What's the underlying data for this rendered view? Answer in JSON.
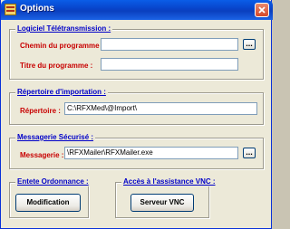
{
  "window": {
    "title": "Options",
    "colors": {
      "title_bar": "#0a4fd6",
      "group_title": "#0000c8",
      "label": "#c80000",
      "dialog_bg": "#ece9d8"
    }
  },
  "logiciel": {
    "title": "Logiciel Télétransmission :",
    "chemin_label": "Chemin du programme :",
    "chemin_value": "",
    "titre_label": "Titre du programme :",
    "titre_value": "",
    "browse_label": "..."
  },
  "repertoire": {
    "title": "Répertoire d'importation :",
    "label": "Répertoire :",
    "value": "C:\\RFXMed\\@Import\\"
  },
  "messagerie": {
    "title": "Messagerie Sécurisé :",
    "label": "Messagerie :",
    "value": "\\RFXMailer\\RFXMailer.exe",
    "browse_label": "..."
  },
  "entete": {
    "title": "Entete Ordonnance :",
    "button": "Modification"
  },
  "vnc": {
    "title": "Accès à l'assistance VNC :",
    "button": "Serveur VNC"
  }
}
